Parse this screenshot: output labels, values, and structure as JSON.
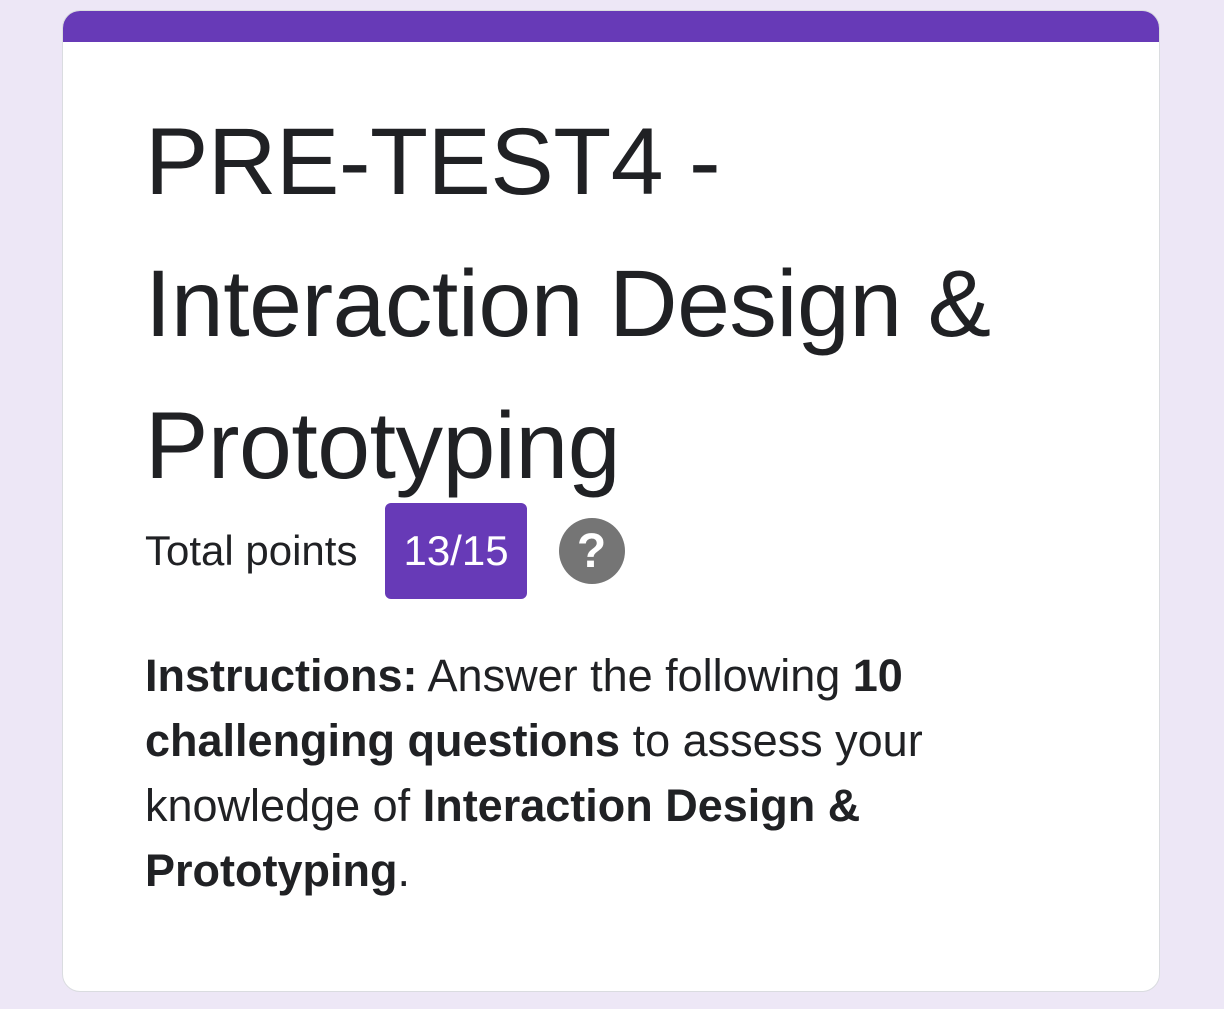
{
  "form": {
    "title": "PRE-TEST4 - Interaction Design & Prototyping",
    "total_points_label": "Total points",
    "score": "13/15",
    "help_glyph": "?",
    "help_icon": "help-circle-icon",
    "instructions": {
      "label": "Instructions:",
      "text1": " Answer the following ",
      "bold1": "10 challenging questions",
      "text2": " to assess your knowledge of ",
      "bold2": "Interaction Design & Prototyping",
      "text3": "."
    }
  },
  "colors": {
    "accent": "#673ab7",
    "background": "#ede7f6",
    "card": "#ffffff",
    "help_icon": "#757575",
    "text": "#202124"
  }
}
